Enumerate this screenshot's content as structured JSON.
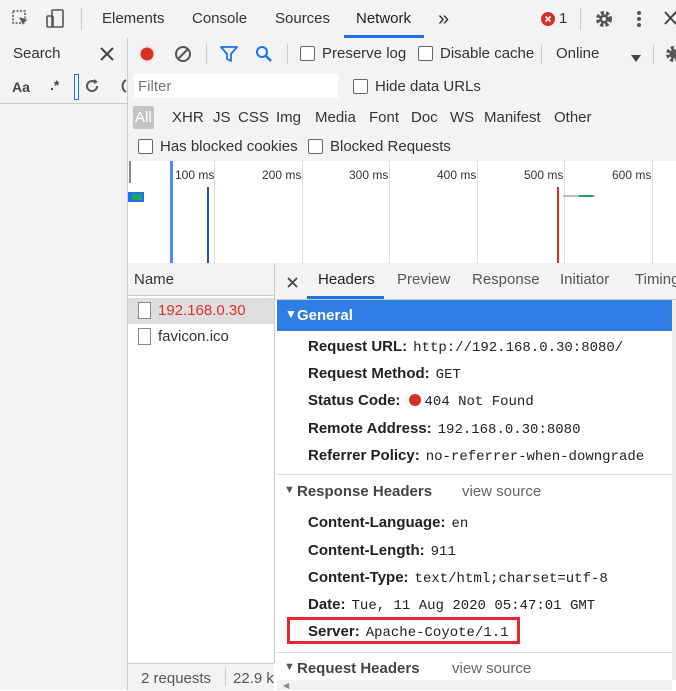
{
  "topbar": {
    "tabs": [
      "Elements",
      "Console",
      "Sources",
      "Network"
    ],
    "more": "»",
    "error_count": "1"
  },
  "search_panel": {
    "title": "Search",
    "case_label": "Aa",
    "regex_label": ".*"
  },
  "toolbar": {
    "preserve_log": "Preserve log",
    "disable_cache": "Disable cache",
    "throttling": "Online"
  },
  "filter": {
    "placeholder": "Filter",
    "hide_data_urls": "Hide data URLs",
    "types": [
      "All",
      "XHR",
      "JS",
      "CSS",
      "Img",
      "Media",
      "Font",
      "Doc",
      "WS",
      "Manifest",
      "Other"
    ],
    "has_blocked_cookies": "Has blocked cookies",
    "blocked_requests": "Blocked Requests"
  },
  "timeline": {
    "ticks": [
      "100 ms",
      "200 ms",
      "300 ms",
      "400 ms",
      "500 ms",
      "600 ms"
    ]
  },
  "requests": {
    "header": "Name",
    "items": [
      "192.168.0.30",
      "favicon.ico"
    ],
    "summary_count": "2 requests",
    "summary_size": "22.9 k"
  },
  "details": {
    "tabs": [
      "Headers",
      "Preview",
      "Response",
      "Initiator",
      "Timing"
    ],
    "general": {
      "title": "General",
      "rows": [
        {
          "key": "Request URL:",
          "value": "http://192.168.0.30:8080/"
        },
        {
          "key": "Request Method:",
          "value": "GET"
        },
        {
          "key": "Status Code:",
          "value": "404 Not Found"
        },
        {
          "key": "Remote Address:",
          "value": "192.168.0.30:8080"
        },
        {
          "key": "Referrer Policy:",
          "value": "no-referrer-when-downgrade"
        }
      ]
    },
    "response_headers": {
      "title": "Response Headers",
      "view_source": "view source",
      "rows": [
        {
          "key": "Content-Language:",
          "value": "en"
        },
        {
          "key": "Content-Length:",
          "value": "911"
        },
        {
          "key": "Content-Type:",
          "value": "text/html;charset=utf-8"
        },
        {
          "key": "Date:",
          "value": "Tue, 11 Aug 2020 05:47:01 GMT"
        },
        {
          "key": "Server:",
          "value": "Apache-Coyote/1.1"
        }
      ]
    },
    "request_headers": {
      "title": "Request Headers",
      "view_source": "view source"
    }
  },
  "colors": {
    "accent": "#1a73e8",
    "record": "#d93025",
    "highlight_box": "#e8262f",
    "general_bar": "#2f7ee6",
    "error_red": "#d93025"
  }
}
